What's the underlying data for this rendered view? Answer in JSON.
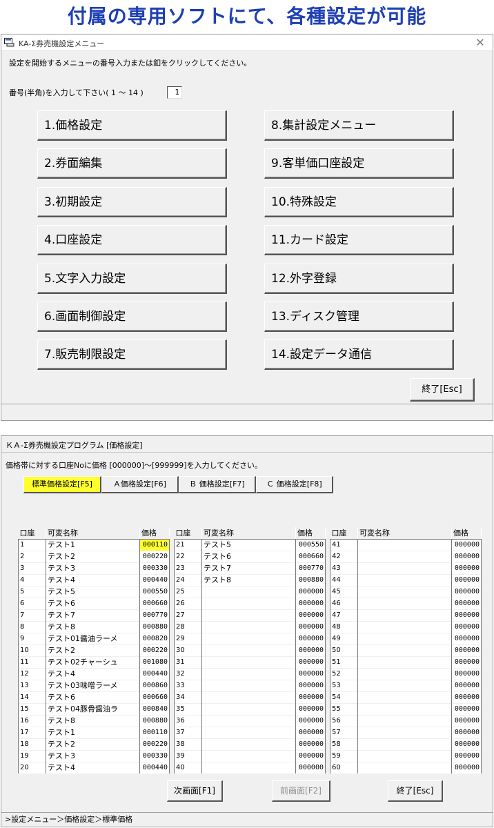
{
  "banner": "付属の専用ソフトにて、各種設定が可能",
  "menu_window": {
    "title": "KA-Σ券売機設定メニュー",
    "instruction": "設定を開始するメニューの番号入力または釦をクリックしてください。",
    "prompt": "番号(半角)を入力して下さい( 1 ～ 14 )",
    "number_value": "1",
    "buttons": [
      "1.価格設定",
      "2.券面編集",
      "3.初期設定",
      "4.口座設定",
      "5.文字入力設定",
      "6.画面制御設定",
      "7.販売制限設定",
      "8.集計設定メニュー",
      "9.客単価口座設定",
      "10.特殊設定",
      "11.カード設定",
      "12.外字登録",
      "13.ディスク管理",
      "14.設定データ通信"
    ],
    "exit_label": "終了[Esc]"
  },
  "price_window": {
    "title": "ＫＡ-Σ券売機設定プログラム [価格設定]",
    "instruction": "価格帯に対する口座Noに価格 [000000]～[999999]を入力してください。",
    "tabs": [
      "標準価格設定[F5]",
      "Ａ価格設定[F6]",
      "Ｂ 価格設定[F7]",
      "Ｃ 価格設定[F8]"
    ],
    "active_tab": 0,
    "headers": {
      "account": "口座",
      "name": "可変名称",
      "price": "価格"
    },
    "columns": [
      {
        "rows": [
          [
            "1",
            "テスト1",
            "000110"
          ],
          [
            "2",
            "テスト2",
            "000220"
          ],
          [
            "3",
            "テスト3",
            "000330"
          ],
          [
            "4",
            "テスト4",
            "000440"
          ],
          [
            "5",
            "テスト5",
            "000550"
          ],
          [
            "6",
            "テスト6",
            "000660"
          ],
          [
            "7",
            "テスト7",
            "000770"
          ],
          [
            "8",
            "テスト8",
            "000880"
          ],
          [
            "9",
            "テスト01醤油ラーメ",
            "000820"
          ],
          [
            "10",
            "テスト2",
            "000220"
          ],
          [
            "11",
            "テスト02チャーシュ",
            "001080"
          ],
          [
            "12",
            "テスト4",
            "000440"
          ],
          [
            "13",
            "テスト03味噌ラーメ",
            "000860"
          ],
          [
            "14",
            "テスト6",
            "000660"
          ],
          [
            "15",
            "テスト04豚骨醤油ラ",
            "000840"
          ],
          [
            "16",
            "テスト8",
            "000880"
          ],
          [
            "17",
            "テスト1",
            "000110"
          ],
          [
            "18",
            "テスト2",
            "000220"
          ],
          [
            "19",
            "テスト3",
            "000330"
          ],
          [
            "20",
            "テスト4",
            "000440"
          ]
        ]
      },
      {
        "rows": [
          [
            "21",
            "テスト5",
            "000550"
          ],
          [
            "22",
            "テスト6",
            "000660"
          ],
          [
            "23",
            "テスト7",
            "000770"
          ],
          [
            "24",
            "テスト8",
            "000880"
          ],
          [
            "25",
            "",
            "000000"
          ],
          [
            "26",
            "",
            "000000"
          ],
          [
            "27",
            "",
            "000000"
          ],
          [
            "28",
            "",
            "000000"
          ],
          [
            "29",
            "",
            "000000"
          ],
          [
            "30",
            "",
            "000000"
          ],
          [
            "31",
            "",
            "000000"
          ],
          [
            "32",
            "",
            "000000"
          ],
          [
            "33",
            "",
            "000000"
          ],
          [
            "34",
            "",
            "000000"
          ],
          [
            "35",
            "",
            "000000"
          ],
          [
            "36",
            "",
            "000000"
          ],
          [
            "37",
            "",
            "000000"
          ],
          [
            "38",
            "",
            "000000"
          ],
          [
            "39",
            "",
            "000000"
          ],
          [
            "40",
            "",
            "000000"
          ]
        ]
      },
      {
        "rows": [
          [
            "41",
            "",
            "000000"
          ],
          [
            "42",
            "",
            "000000"
          ],
          [
            "43",
            "",
            "000000"
          ],
          [
            "44",
            "",
            "000000"
          ],
          [
            "45",
            "",
            "000000"
          ],
          [
            "46",
            "",
            "000000"
          ],
          [
            "47",
            "",
            "000000"
          ],
          [
            "48",
            "",
            "000000"
          ],
          [
            "49",
            "",
            "000000"
          ],
          [
            "50",
            "",
            "000000"
          ],
          [
            "51",
            "",
            "000000"
          ],
          [
            "52",
            "",
            "000000"
          ],
          [
            "53",
            "",
            "000000"
          ],
          [
            "54",
            "",
            "000000"
          ],
          [
            "55",
            "",
            "000000"
          ],
          [
            "56",
            "",
            "000000"
          ],
          [
            "57",
            "",
            "000000"
          ],
          [
            "58",
            "",
            "000000"
          ],
          [
            "59",
            "",
            "000000"
          ],
          [
            "60",
            "",
            "000000"
          ]
        ]
      }
    ],
    "next_label": "次画面[F1]",
    "prev_label": "前画面[F2]",
    "exit_label": "終了[Esc]",
    "status": ">設定メニュー＞価格設定＞標準価格"
  }
}
